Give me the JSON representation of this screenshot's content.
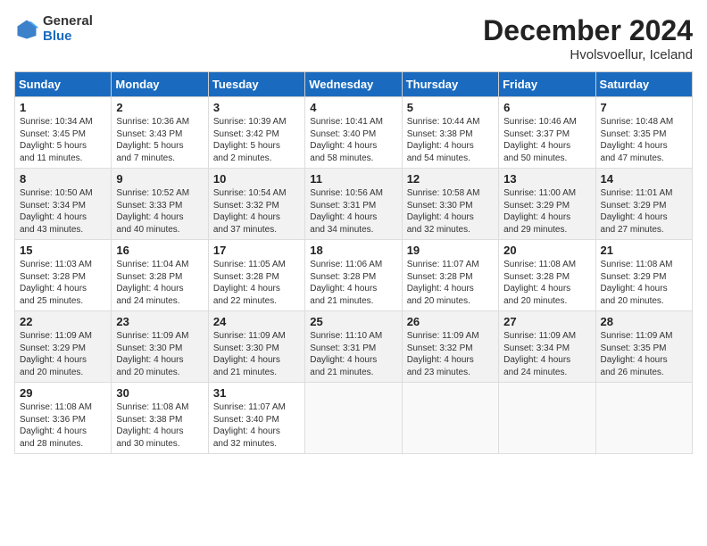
{
  "header": {
    "logo_general": "General",
    "logo_blue": "Blue",
    "month_title": "December 2024",
    "location": "Hvolsvoellur, Iceland"
  },
  "days_of_week": [
    "Sunday",
    "Monday",
    "Tuesday",
    "Wednesday",
    "Thursday",
    "Friday",
    "Saturday"
  ],
  "weeks": [
    [
      {
        "day": 1,
        "info": "Sunrise: 10:34 AM\nSunset: 3:45 PM\nDaylight: 5 hours\nand 11 minutes."
      },
      {
        "day": 2,
        "info": "Sunrise: 10:36 AM\nSunset: 3:43 PM\nDaylight: 5 hours\nand 7 minutes."
      },
      {
        "day": 3,
        "info": "Sunrise: 10:39 AM\nSunset: 3:42 PM\nDaylight: 5 hours\nand 2 minutes."
      },
      {
        "day": 4,
        "info": "Sunrise: 10:41 AM\nSunset: 3:40 PM\nDaylight: 4 hours\nand 58 minutes."
      },
      {
        "day": 5,
        "info": "Sunrise: 10:44 AM\nSunset: 3:38 PM\nDaylight: 4 hours\nand 54 minutes."
      },
      {
        "day": 6,
        "info": "Sunrise: 10:46 AM\nSunset: 3:37 PM\nDaylight: 4 hours\nand 50 minutes."
      },
      {
        "day": 7,
        "info": "Sunrise: 10:48 AM\nSunset: 3:35 PM\nDaylight: 4 hours\nand 47 minutes."
      }
    ],
    [
      {
        "day": 8,
        "info": "Sunrise: 10:50 AM\nSunset: 3:34 PM\nDaylight: 4 hours\nand 43 minutes."
      },
      {
        "day": 9,
        "info": "Sunrise: 10:52 AM\nSunset: 3:33 PM\nDaylight: 4 hours\nand 40 minutes."
      },
      {
        "day": 10,
        "info": "Sunrise: 10:54 AM\nSunset: 3:32 PM\nDaylight: 4 hours\nand 37 minutes."
      },
      {
        "day": 11,
        "info": "Sunrise: 10:56 AM\nSunset: 3:31 PM\nDaylight: 4 hours\nand 34 minutes."
      },
      {
        "day": 12,
        "info": "Sunrise: 10:58 AM\nSunset: 3:30 PM\nDaylight: 4 hours\nand 32 minutes."
      },
      {
        "day": 13,
        "info": "Sunrise: 11:00 AM\nSunset: 3:29 PM\nDaylight: 4 hours\nand 29 minutes."
      },
      {
        "day": 14,
        "info": "Sunrise: 11:01 AM\nSunset: 3:29 PM\nDaylight: 4 hours\nand 27 minutes."
      }
    ],
    [
      {
        "day": 15,
        "info": "Sunrise: 11:03 AM\nSunset: 3:28 PM\nDaylight: 4 hours\nand 25 minutes."
      },
      {
        "day": 16,
        "info": "Sunrise: 11:04 AM\nSunset: 3:28 PM\nDaylight: 4 hours\nand 24 minutes."
      },
      {
        "day": 17,
        "info": "Sunrise: 11:05 AM\nSunset: 3:28 PM\nDaylight: 4 hours\nand 22 minutes."
      },
      {
        "day": 18,
        "info": "Sunrise: 11:06 AM\nSunset: 3:28 PM\nDaylight: 4 hours\nand 21 minutes."
      },
      {
        "day": 19,
        "info": "Sunrise: 11:07 AM\nSunset: 3:28 PM\nDaylight: 4 hours\nand 20 minutes."
      },
      {
        "day": 20,
        "info": "Sunrise: 11:08 AM\nSunset: 3:28 PM\nDaylight: 4 hours\nand 20 minutes."
      },
      {
        "day": 21,
        "info": "Sunrise: 11:08 AM\nSunset: 3:29 PM\nDaylight: 4 hours\nand 20 minutes."
      }
    ],
    [
      {
        "day": 22,
        "info": "Sunrise: 11:09 AM\nSunset: 3:29 PM\nDaylight: 4 hours\nand 20 minutes."
      },
      {
        "day": 23,
        "info": "Sunrise: 11:09 AM\nSunset: 3:30 PM\nDaylight: 4 hours\nand 20 minutes."
      },
      {
        "day": 24,
        "info": "Sunrise: 11:09 AM\nSunset: 3:30 PM\nDaylight: 4 hours\nand 21 minutes."
      },
      {
        "day": 25,
        "info": "Sunrise: 11:10 AM\nSunset: 3:31 PM\nDaylight: 4 hours\nand 21 minutes."
      },
      {
        "day": 26,
        "info": "Sunrise: 11:09 AM\nSunset: 3:32 PM\nDaylight: 4 hours\nand 23 minutes."
      },
      {
        "day": 27,
        "info": "Sunrise: 11:09 AM\nSunset: 3:34 PM\nDaylight: 4 hours\nand 24 minutes."
      },
      {
        "day": 28,
        "info": "Sunrise: 11:09 AM\nSunset: 3:35 PM\nDaylight: 4 hours\nand 26 minutes."
      }
    ],
    [
      {
        "day": 29,
        "info": "Sunrise: 11:08 AM\nSunset: 3:36 PM\nDaylight: 4 hours\nand 28 minutes."
      },
      {
        "day": 30,
        "info": "Sunrise: 11:08 AM\nSunset: 3:38 PM\nDaylight: 4 hours\nand 30 minutes."
      },
      {
        "day": 31,
        "info": "Sunrise: 11:07 AM\nSunset: 3:40 PM\nDaylight: 4 hours\nand 32 minutes."
      },
      null,
      null,
      null,
      null
    ]
  ]
}
